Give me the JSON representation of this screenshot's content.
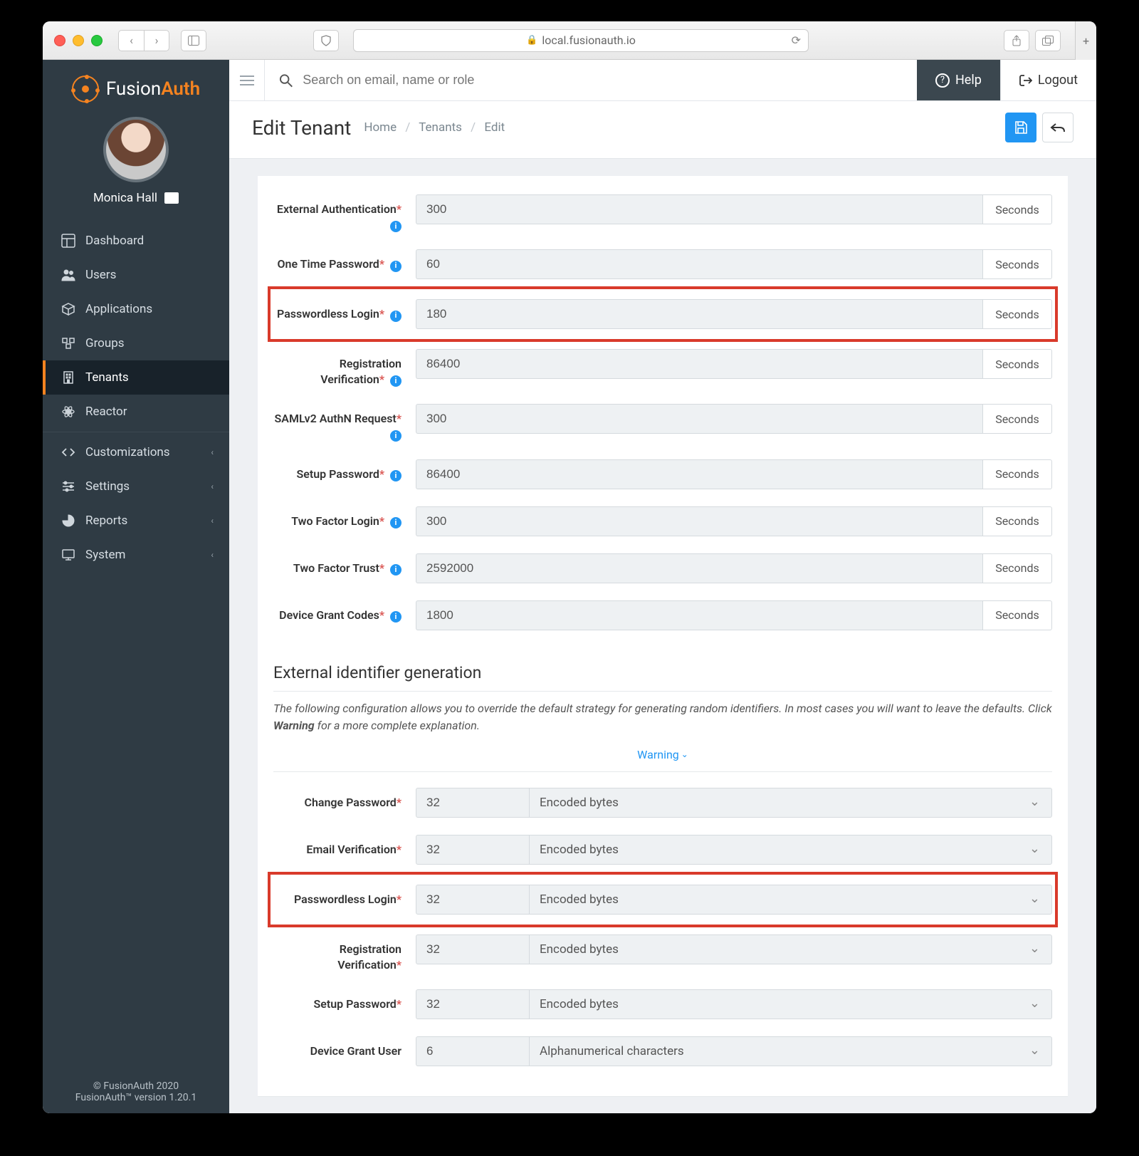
{
  "browser": {
    "url": "local.fusionauth.io"
  },
  "brand": {
    "name_a": "Fusion",
    "name_b": "Auth"
  },
  "user": {
    "name": "Monica Hall"
  },
  "sidebar": {
    "items": [
      {
        "label": "Dashboard"
      },
      {
        "label": "Users"
      },
      {
        "label": "Applications"
      },
      {
        "label": "Groups"
      },
      {
        "label": "Tenants"
      },
      {
        "label": "Reactor"
      },
      {
        "label": "Customizations"
      },
      {
        "label": "Settings"
      },
      {
        "label": "Reports"
      },
      {
        "label": "System"
      }
    ],
    "copyright": "© FusionAuth 2020",
    "version": "FusionAuth™ version 1.20.1"
  },
  "topbar": {
    "search_placeholder": "Search on email, name or role",
    "help": "Help",
    "logout": "Logout"
  },
  "header": {
    "title": "Edit Tenant",
    "crumbs": [
      "Home",
      "Tenants",
      "Edit"
    ]
  },
  "durations": {
    "unit": "Seconds",
    "rows": [
      {
        "label": "External Authentication",
        "value": "300",
        "info": true,
        "highlight": false
      },
      {
        "label": "One Time Password",
        "value": "60",
        "info": true,
        "highlight": false
      },
      {
        "label": "Passwordless Login",
        "value": "180",
        "info": true,
        "highlight": true
      },
      {
        "label": "Registration Verification",
        "value": "86400",
        "info": true,
        "highlight": false
      },
      {
        "label": "SAMLv2 AuthN Request",
        "value": "300",
        "info": true,
        "highlight": false
      },
      {
        "label": "Setup Password",
        "value": "86400",
        "info": true,
        "highlight": false
      },
      {
        "label": "Two Factor Login",
        "value": "300",
        "info": true,
        "highlight": false
      },
      {
        "label": "Two Factor Trust",
        "value": "2592000",
        "info": true,
        "highlight": false
      },
      {
        "label": "Device Grant Codes",
        "value": "1800",
        "info": true,
        "highlight": false
      }
    ]
  },
  "section2": {
    "title": "External identifier generation",
    "desc_a": "The following configuration allows you to override the default strategy for generating random identifiers. In most cases you will want to leave the defaults. Click ",
    "desc_b": "Warning",
    "desc_c": " for a more complete explanation.",
    "warning_label": "Warning",
    "rows": [
      {
        "label": "Change Password",
        "value": "32",
        "type": "Encoded bytes",
        "highlight": false,
        "req": true
      },
      {
        "label": "Email Verification",
        "value": "32",
        "type": "Encoded bytes",
        "highlight": false,
        "req": true
      },
      {
        "label": "Passwordless Login",
        "value": "32",
        "type": "Encoded bytes",
        "highlight": true,
        "req": true
      },
      {
        "label": "Registration Verification",
        "value": "32",
        "type": "Encoded bytes",
        "highlight": false,
        "req": true
      },
      {
        "label": "Setup Password",
        "value": "32",
        "type": "Encoded bytes",
        "highlight": false,
        "req": true
      },
      {
        "label": "Device Grant User",
        "value": "6",
        "type": "Alphanumerical characters",
        "highlight": false,
        "req": false
      }
    ]
  }
}
